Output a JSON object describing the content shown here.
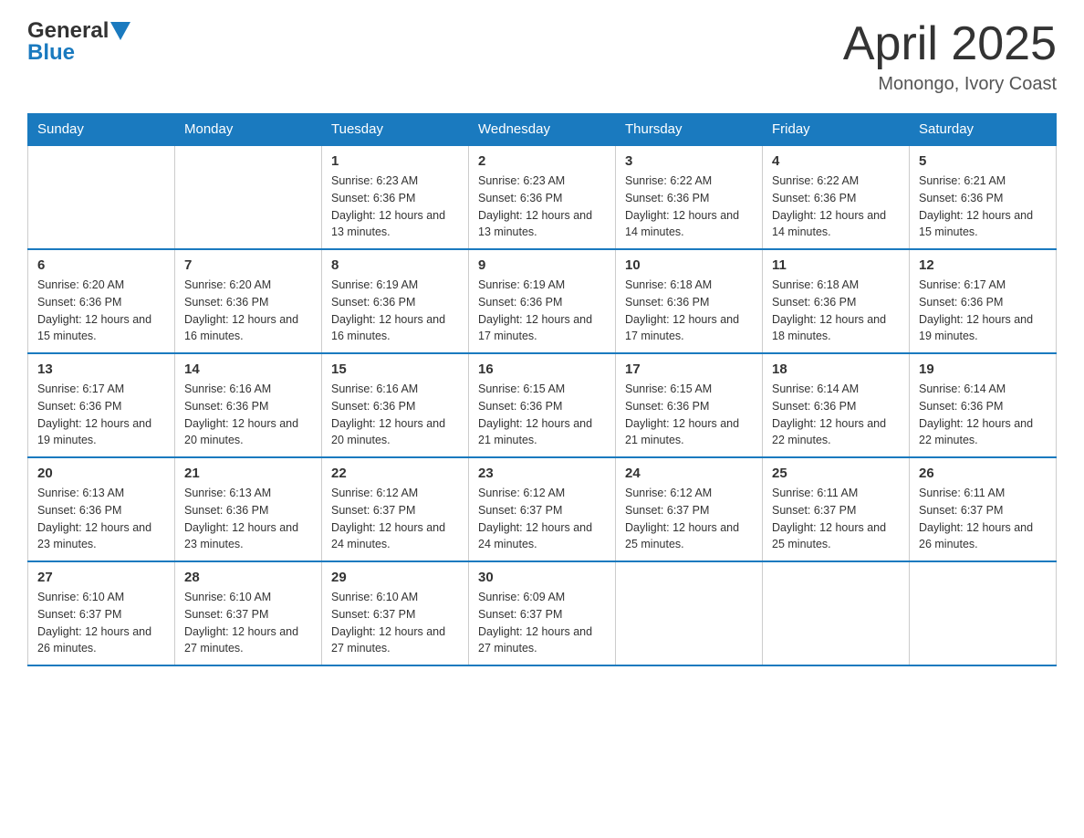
{
  "header": {
    "logo_general": "General",
    "logo_blue": "Blue",
    "month_title": "April 2025",
    "location": "Monongo, Ivory Coast"
  },
  "days_of_week": [
    "Sunday",
    "Monday",
    "Tuesday",
    "Wednesday",
    "Thursday",
    "Friday",
    "Saturday"
  ],
  "weeks": [
    [
      {
        "day": "",
        "sunrise": "",
        "sunset": "",
        "daylight": ""
      },
      {
        "day": "",
        "sunrise": "",
        "sunset": "",
        "daylight": ""
      },
      {
        "day": "1",
        "sunrise": "Sunrise: 6:23 AM",
        "sunset": "Sunset: 6:36 PM",
        "daylight": "Daylight: 12 hours and 13 minutes."
      },
      {
        "day": "2",
        "sunrise": "Sunrise: 6:23 AM",
        "sunset": "Sunset: 6:36 PM",
        "daylight": "Daylight: 12 hours and 13 minutes."
      },
      {
        "day": "3",
        "sunrise": "Sunrise: 6:22 AM",
        "sunset": "Sunset: 6:36 PM",
        "daylight": "Daylight: 12 hours and 14 minutes."
      },
      {
        "day": "4",
        "sunrise": "Sunrise: 6:22 AM",
        "sunset": "Sunset: 6:36 PM",
        "daylight": "Daylight: 12 hours and 14 minutes."
      },
      {
        "day": "5",
        "sunrise": "Sunrise: 6:21 AM",
        "sunset": "Sunset: 6:36 PM",
        "daylight": "Daylight: 12 hours and 15 minutes."
      }
    ],
    [
      {
        "day": "6",
        "sunrise": "Sunrise: 6:20 AM",
        "sunset": "Sunset: 6:36 PM",
        "daylight": "Daylight: 12 hours and 15 minutes."
      },
      {
        "day": "7",
        "sunrise": "Sunrise: 6:20 AM",
        "sunset": "Sunset: 6:36 PM",
        "daylight": "Daylight: 12 hours and 16 minutes."
      },
      {
        "day": "8",
        "sunrise": "Sunrise: 6:19 AM",
        "sunset": "Sunset: 6:36 PM",
        "daylight": "Daylight: 12 hours and 16 minutes."
      },
      {
        "day": "9",
        "sunrise": "Sunrise: 6:19 AM",
        "sunset": "Sunset: 6:36 PM",
        "daylight": "Daylight: 12 hours and 17 minutes."
      },
      {
        "day": "10",
        "sunrise": "Sunrise: 6:18 AM",
        "sunset": "Sunset: 6:36 PM",
        "daylight": "Daylight: 12 hours and 17 minutes."
      },
      {
        "day": "11",
        "sunrise": "Sunrise: 6:18 AM",
        "sunset": "Sunset: 6:36 PM",
        "daylight": "Daylight: 12 hours and 18 minutes."
      },
      {
        "day": "12",
        "sunrise": "Sunrise: 6:17 AM",
        "sunset": "Sunset: 6:36 PM",
        "daylight": "Daylight: 12 hours and 19 minutes."
      }
    ],
    [
      {
        "day": "13",
        "sunrise": "Sunrise: 6:17 AM",
        "sunset": "Sunset: 6:36 PM",
        "daylight": "Daylight: 12 hours and 19 minutes."
      },
      {
        "day": "14",
        "sunrise": "Sunrise: 6:16 AM",
        "sunset": "Sunset: 6:36 PM",
        "daylight": "Daylight: 12 hours and 20 minutes."
      },
      {
        "day": "15",
        "sunrise": "Sunrise: 6:16 AM",
        "sunset": "Sunset: 6:36 PM",
        "daylight": "Daylight: 12 hours and 20 minutes."
      },
      {
        "day": "16",
        "sunrise": "Sunrise: 6:15 AM",
        "sunset": "Sunset: 6:36 PM",
        "daylight": "Daylight: 12 hours and 21 minutes."
      },
      {
        "day": "17",
        "sunrise": "Sunrise: 6:15 AM",
        "sunset": "Sunset: 6:36 PM",
        "daylight": "Daylight: 12 hours and 21 minutes."
      },
      {
        "day": "18",
        "sunrise": "Sunrise: 6:14 AM",
        "sunset": "Sunset: 6:36 PM",
        "daylight": "Daylight: 12 hours and 22 minutes."
      },
      {
        "day": "19",
        "sunrise": "Sunrise: 6:14 AM",
        "sunset": "Sunset: 6:36 PM",
        "daylight": "Daylight: 12 hours and 22 minutes."
      }
    ],
    [
      {
        "day": "20",
        "sunrise": "Sunrise: 6:13 AM",
        "sunset": "Sunset: 6:36 PM",
        "daylight": "Daylight: 12 hours and 23 minutes."
      },
      {
        "day": "21",
        "sunrise": "Sunrise: 6:13 AM",
        "sunset": "Sunset: 6:36 PM",
        "daylight": "Daylight: 12 hours and 23 minutes."
      },
      {
        "day": "22",
        "sunrise": "Sunrise: 6:12 AM",
        "sunset": "Sunset: 6:37 PM",
        "daylight": "Daylight: 12 hours and 24 minutes."
      },
      {
        "day": "23",
        "sunrise": "Sunrise: 6:12 AM",
        "sunset": "Sunset: 6:37 PM",
        "daylight": "Daylight: 12 hours and 24 minutes."
      },
      {
        "day": "24",
        "sunrise": "Sunrise: 6:12 AM",
        "sunset": "Sunset: 6:37 PM",
        "daylight": "Daylight: 12 hours and 25 minutes."
      },
      {
        "day": "25",
        "sunrise": "Sunrise: 6:11 AM",
        "sunset": "Sunset: 6:37 PM",
        "daylight": "Daylight: 12 hours and 25 minutes."
      },
      {
        "day": "26",
        "sunrise": "Sunrise: 6:11 AM",
        "sunset": "Sunset: 6:37 PM",
        "daylight": "Daylight: 12 hours and 26 minutes."
      }
    ],
    [
      {
        "day": "27",
        "sunrise": "Sunrise: 6:10 AM",
        "sunset": "Sunset: 6:37 PM",
        "daylight": "Daylight: 12 hours and 26 minutes."
      },
      {
        "day": "28",
        "sunrise": "Sunrise: 6:10 AM",
        "sunset": "Sunset: 6:37 PM",
        "daylight": "Daylight: 12 hours and 27 minutes."
      },
      {
        "day": "29",
        "sunrise": "Sunrise: 6:10 AM",
        "sunset": "Sunset: 6:37 PM",
        "daylight": "Daylight: 12 hours and 27 minutes."
      },
      {
        "day": "30",
        "sunrise": "Sunrise: 6:09 AM",
        "sunset": "Sunset: 6:37 PM",
        "daylight": "Daylight: 12 hours and 27 minutes."
      },
      {
        "day": "",
        "sunrise": "",
        "sunset": "",
        "daylight": ""
      },
      {
        "day": "",
        "sunrise": "",
        "sunset": "",
        "daylight": ""
      },
      {
        "day": "",
        "sunrise": "",
        "sunset": "",
        "daylight": ""
      }
    ]
  ]
}
